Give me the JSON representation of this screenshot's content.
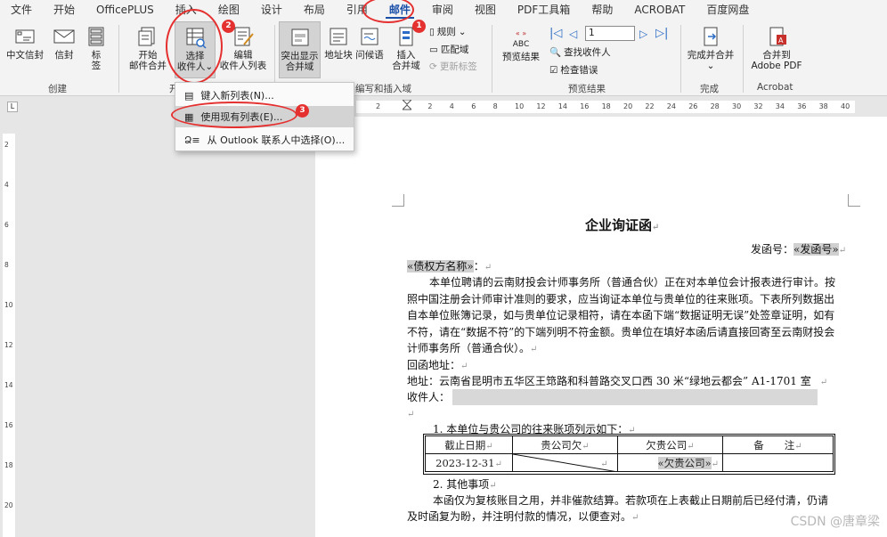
{
  "tabs": [
    "文件",
    "开始",
    "OfficePLUS",
    "插入",
    "绘图",
    "设计",
    "布局",
    "引用",
    "邮件",
    "审阅",
    "视图",
    "PDF工具箱",
    "帮助",
    "ACROBAT",
    "百度网盘"
  ],
  "active_tab": "邮件",
  "ribbon": {
    "create": {
      "envelope": "中文信封",
      "letter": "信封",
      "label_l1": "标",
      "label_l2": "签",
      "group": "创建"
    },
    "start_merge": {
      "start_l1": "开始",
      "start_l2": "邮件合并",
      "select_l1": "选择",
      "select_l2": "收件人",
      "edit_l1": "编辑",
      "edit_l2": "收件人列表",
      "group_partial": "开"
    },
    "write_insert": {
      "highlight_l1": "突出显示",
      "highlight_l2": "合并域",
      "address": "地址块",
      "greeting": "问候语",
      "insert_l1": "插入",
      "insert_l2": "合并域",
      "rules": "规则",
      "match": "匹配域",
      "update": "更新标签",
      "group": "编写和插入域"
    },
    "preview": {
      "preview_l1": "预览结果",
      "abc": "ABC",
      "record": "1",
      "find": "查找收件人",
      "check": "检查错误",
      "group": "预览结果"
    },
    "finish": {
      "finish_l1": "完成并合并",
      "group": "完成"
    },
    "acrobat": {
      "merge_l1": "合并到",
      "merge_l2": "Adobe PDF",
      "group": "Acrobat"
    }
  },
  "dropdown": {
    "items": [
      "键入新列表(N)...",
      "使用现有列表(E)...",
      "从 Outlook 联系人中选择(O)..."
    ]
  },
  "badges": [
    "1",
    "2",
    "3"
  ],
  "ruler": {
    "h": [
      "2",
      "2",
      "4",
      "6",
      "8",
      "10",
      "12",
      "14",
      "16",
      "18",
      "20",
      "22",
      "24",
      "26",
      "28",
      "30",
      "32",
      "34",
      "36",
      "38",
      "40"
    ],
    "v": [
      "2",
      "4",
      "6",
      "8",
      "10",
      "12",
      "14",
      "16",
      "18",
      "20"
    ],
    "corner": "L"
  },
  "document": {
    "title": "企业询证函",
    "number_label": "发函号：",
    "number_field": "«发函号»",
    "creditor_field": "«债权方名称»",
    "creditor_suffix": "：",
    "p1": "本单位聘请的云南财投会计师事务所（普通合伙）正在对本单位会计报表进行审计。按",
    "p2": "照中国注册会计师审计准则的要求，应当询证本单位与贵单位的往来账项。下表所列数据出",
    "p3": "自本单位账簿记录，如与贵单位记录相符，请在本函下端“数据证明无误”处签章证明，如有",
    "p4": "不符，请在“数据不符”的下端列明不符金额。贵单位在填好本函后请直接回寄至云南财投会",
    "p5": "计师事务所（普通合伙）。",
    "reply": "回函地址：",
    "address": "地址：云南省昆明市五华区王筇路和科普路交叉口西 30 米“绿地云都会” A1-1701 室",
    "recipient": "收件人：",
    "item1": "1.  本单位与贵公司的往来账项列示如下：",
    "table_headers": [
      "截止日期",
      "贵公司欠",
      "欠贵公司",
      "备　　注"
    ],
    "table_row": [
      "2023-12-31",
      "",
      "«欠贵公司»",
      ""
    ],
    "item2": "2.  其他事项",
    "p6": "本函仅为复核账目之用，并非催款结算。若款项在上表截止日期前后已经付清，仍请",
    "p7": "及时函复为盼，并注明付款的情况，以便查对。",
    "watermark": "CSDN @唐章梁"
  },
  "colors": {
    "accent": "#1a4fa8",
    "annotation": "#e53030"
  }
}
